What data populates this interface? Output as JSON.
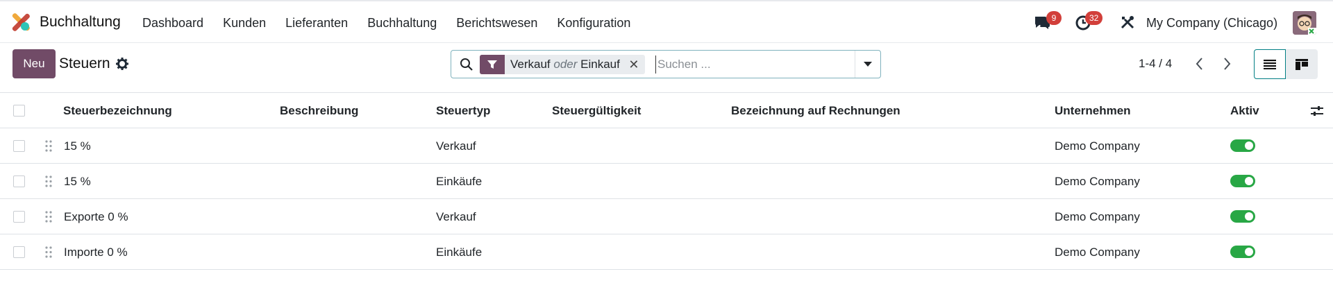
{
  "navbar": {
    "app_name": "Buchhaltung",
    "menu": [
      "Dashboard",
      "Kunden",
      "Lieferanten",
      "Buchhaltung",
      "Berichtswesen",
      "Konfiguration"
    ],
    "messages_badge": "9",
    "activities_badge": "32",
    "company": "My Company (Chicago)"
  },
  "control_panel": {
    "new_button": "Neu",
    "title": "Steuern",
    "search": {
      "facet_part1": "Verkauf",
      "facet_connector": "oder",
      "facet_part2": "Einkauf",
      "facet_close": "✕",
      "placeholder": "Suchen ..."
    },
    "pager": "1-4 / 4"
  },
  "table": {
    "columns": [
      "Steuerbezeichnung",
      "Beschreibung",
      "Steuertyp",
      "Steuergültigkeit",
      "Bezeichnung auf Rechnungen",
      "Unternehmen",
      "Aktiv"
    ],
    "rows": [
      {
        "name": "15 %",
        "description": "",
        "type": "Verkauf",
        "scope": "",
        "invoice_label": "",
        "company": "Demo Company",
        "active": true
      },
      {
        "name": "15 %",
        "description": "",
        "type": "Einkäufe",
        "scope": "",
        "invoice_label": "",
        "company": "Demo Company",
        "active": true
      },
      {
        "name": "Exporte 0 %",
        "description": "",
        "type": "Verkauf",
        "scope": "",
        "invoice_label": "",
        "company": "Demo Company",
        "active": true
      },
      {
        "name": "Importe 0 %",
        "description": "",
        "type": "Einkäufe",
        "scope": "",
        "invoice_label": "",
        "company": "Demo Company",
        "active": true
      }
    ]
  },
  "colors": {
    "primary": "#714b67",
    "accent": "#017e84",
    "toggle_on": "#28a745",
    "badge": "#d23f3a"
  }
}
